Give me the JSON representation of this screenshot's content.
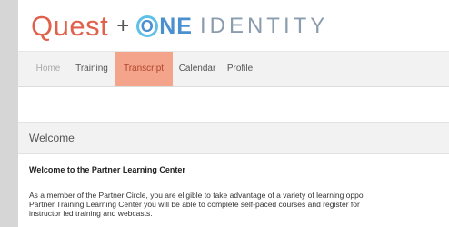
{
  "header": {
    "logo_quest": "Quest",
    "logo_plus": "+",
    "logo_one_o": "O",
    "logo_one_rest": "NE",
    "logo_identity": "IDENTITY"
  },
  "nav": {
    "items": [
      {
        "label": "Home"
      },
      {
        "label": "Training"
      },
      {
        "label": "Transcript"
      },
      {
        "label": "Calendar"
      },
      {
        "label": "Profile"
      }
    ],
    "active_index": 2
  },
  "welcome": {
    "heading": "Welcome"
  },
  "content": {
    "title": "Welcome to the Partner Learning Center",
    "lines": [
      "As a member of the Partner Circle, you are eligible to take advantage of a variety of learning oppo",
      "Partner Training Learning Center you will be able to complete self-paced courses and register for",
      "instructor led training and webcasts."
    ]
  },
  "colors": {
    "quest": "#e0614c",
    "one": "#4a8fd0",
    "identity": "#8a9cae",
    "active_tab": "#f3a48a"
  }
}
